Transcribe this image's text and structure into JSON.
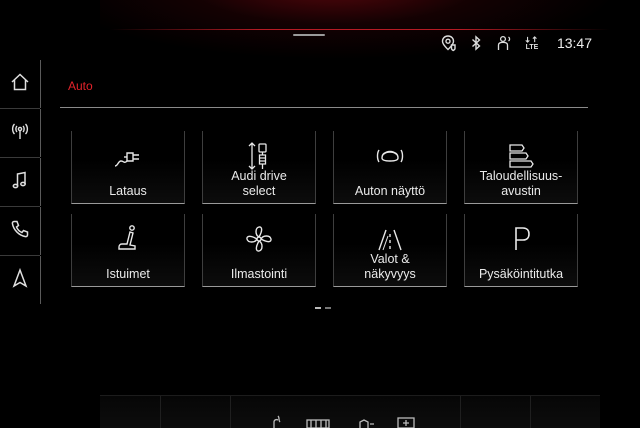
{
  "status_bar": {
    "icons": [
      "location-shield-icon",
      "bluetooth-icon",
      "person-signal-icon",
      "lte-signal-icon"
    ],
    "lte_label": "LTE",
    "time": "13:47"
  },
  "sidebar": {
    "items": [
      {
        "name": "home-icon"
      },
      {
        "name": "radio-icon"
      },
      {
        "name": "music-icon"
      },
      {
        "name": "phone-icon"
      },
      {
        "name": "navigation-icon"
      }
    ]
  },
  "page": {
    "title": "Auto"
  },
  "tiles": [
    {
      "label": "Lataus",
      "icon": "charging-plug-icon"
    },
    {
      "label": "Audi drive\nselect",
      "icon": "drive-select-icon"
    },
    {
      "label": "Auton näyttö",
      "icon": "car-display-icon"
    },
    {
      "label": "Taloudellisuus-\navustin",
      "icon": "efficiency-assistant-icon"
    },
    {
      "label": "Istuimet",
      "icon": "seat-icon"
    },
    {
      "label": "Ilmastointi",
      "icon": "fan-icon"
    },
    {
      "label": "Valot &\nnäkyvyys",
      "icon": "lights-visibility-icon"
    },
    {
      "label": "Pysäköintitutka",
      "icon": "parking-icon"
    }
  ],
  "pager": {
    "pages": 2,
    "current": 1
  },
  "colors": {
    "accent": "#e3232b",
    "background": "#000000",
    "text": "#eaeaea"
  }
}
